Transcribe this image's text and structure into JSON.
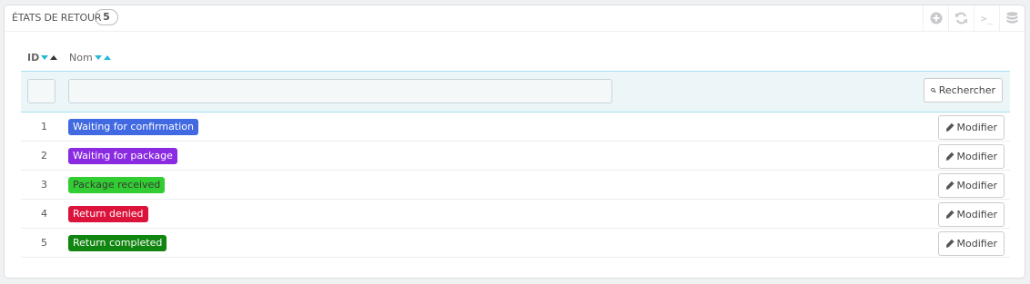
{
  "panel": {
    "title": "États de retour",
    "count": "5"
  },
  "toolbar": {
    "add_icon": "plus-circle-icon",
    "refresh_icon": "refresh-icon",
    "sql_icon": "terminal-icon",
    "sql_label": ">_",
    "export_icon": "database-icon"
  },
  "table": {
    "headers": {
      "id": "ID",
      "name": "Nom"
    },
    "filter": {
      "id_value": "",
      "name_value": "",
      "search_label": "Rechercher"
    },
    "edit_label": "Modifier",
    "rows": [
      {
        "id": "1",
        "name": "Waiting for confirmation",
        "color": "#4169e1",
        "text_color": "#ffffff"
      },
      {
        "id": "2",
        "name": "Waiting for package",
        "color": "#8a2be2",
        "text_color": "#ffffff"
      },
      {
        "id": "3",
        "name": "Package received",
        "color": "#32cd32",
        "text_color": "#383838"
      },
      {
        "id": "4",
        "name": "Return denied",
        "color": "#dc143c",
        "text_color": "#ffffff"
      },
      {
        "id": "5",
        "name": "Return completed",
        "color": "#108510",
        "text_color": "#ffffff"
      }
    ]
  }
}
